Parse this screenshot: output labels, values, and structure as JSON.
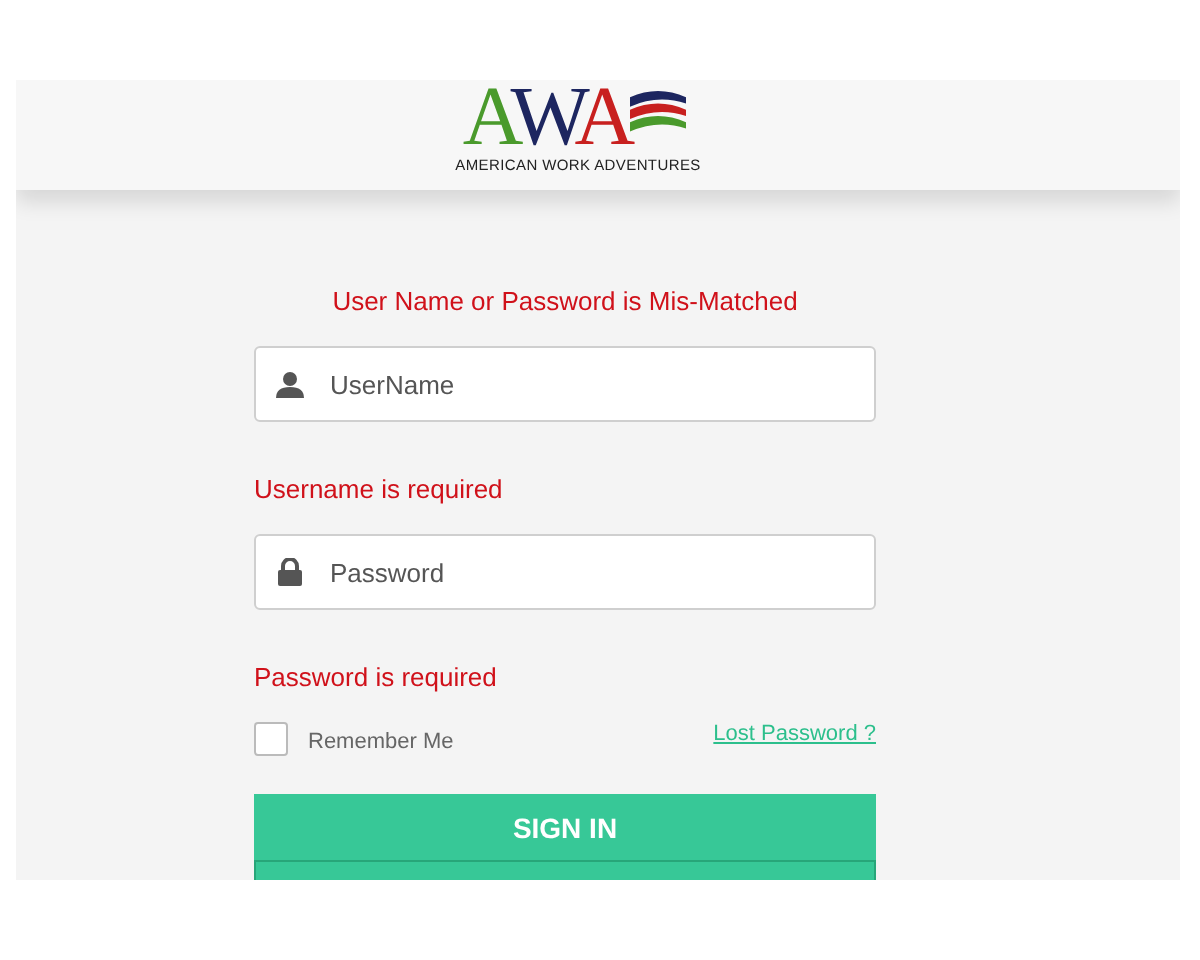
{
  "logo": {
    "letters": "AWA",
    "tagline": "AMERICAN WORK ADVENTURES"
  },
  "form": {
    "error": "User Name or Password is Mis-Matched",
    "fields": [
      {
        "kind": "username",
        "placeholder": "UserName",
        "error": "Username is required"
      },
      {
        "kind": "password",
        "placeholder": "Password",
        "error": "Password is required"
      }
    ],
    "remember": {
      "label": "Remember Me",
      "checked": false
    },
    "lost_password": "Lost Password ?",
    "submit": "SIGN IN"
  }
}
